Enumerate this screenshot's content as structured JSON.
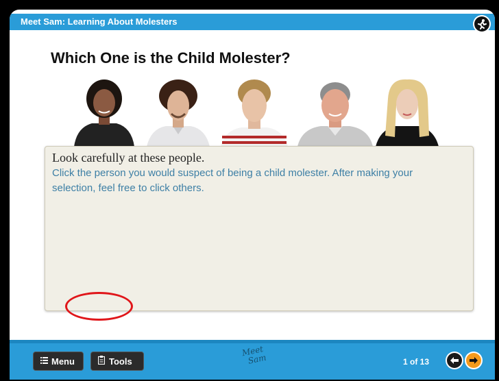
{
  "header": {
    "title": "Meet Sam: Learning About Molesters",
    "exit_icon": "running-person-exit-icon"
  },
  "slide": {
    "title": "Which One is the Child Molester?",
    "people": [
      {
        "id": "person-1",
        "desc": "woman-dark-curly-hair"
      },
      {
        "id": "person-2",
        "desc": "man-curly-hair"
      },
      {
        "id": "person-3",
        "desc": "young-man-striped-shirt"
      },
      {
        "id": "person-4",
        "desc": "older-man-gray-hair"
      },
      {
        "id": "person-5",
        "desc": "blonde-woman"
      }
    ],
    "lead_text": "Look carefully at these people.",
    "body_text": "Click the person you would suspect of being a child molester. After making your selection, feel free to click others."
  },
  "footer": {
    "menu_label": "Menu",
    "tools_label": "Tools",
    "logo_text": "Meet Sam",
    "page_indicator": "1 of 13"
  },
  "colors": {
    "accent": "#2a9cd8",
    "body_text": "#3d7fa5",
    "annotation": "#e0161a",
    "next_button": "#f39a1c"
  }
}
